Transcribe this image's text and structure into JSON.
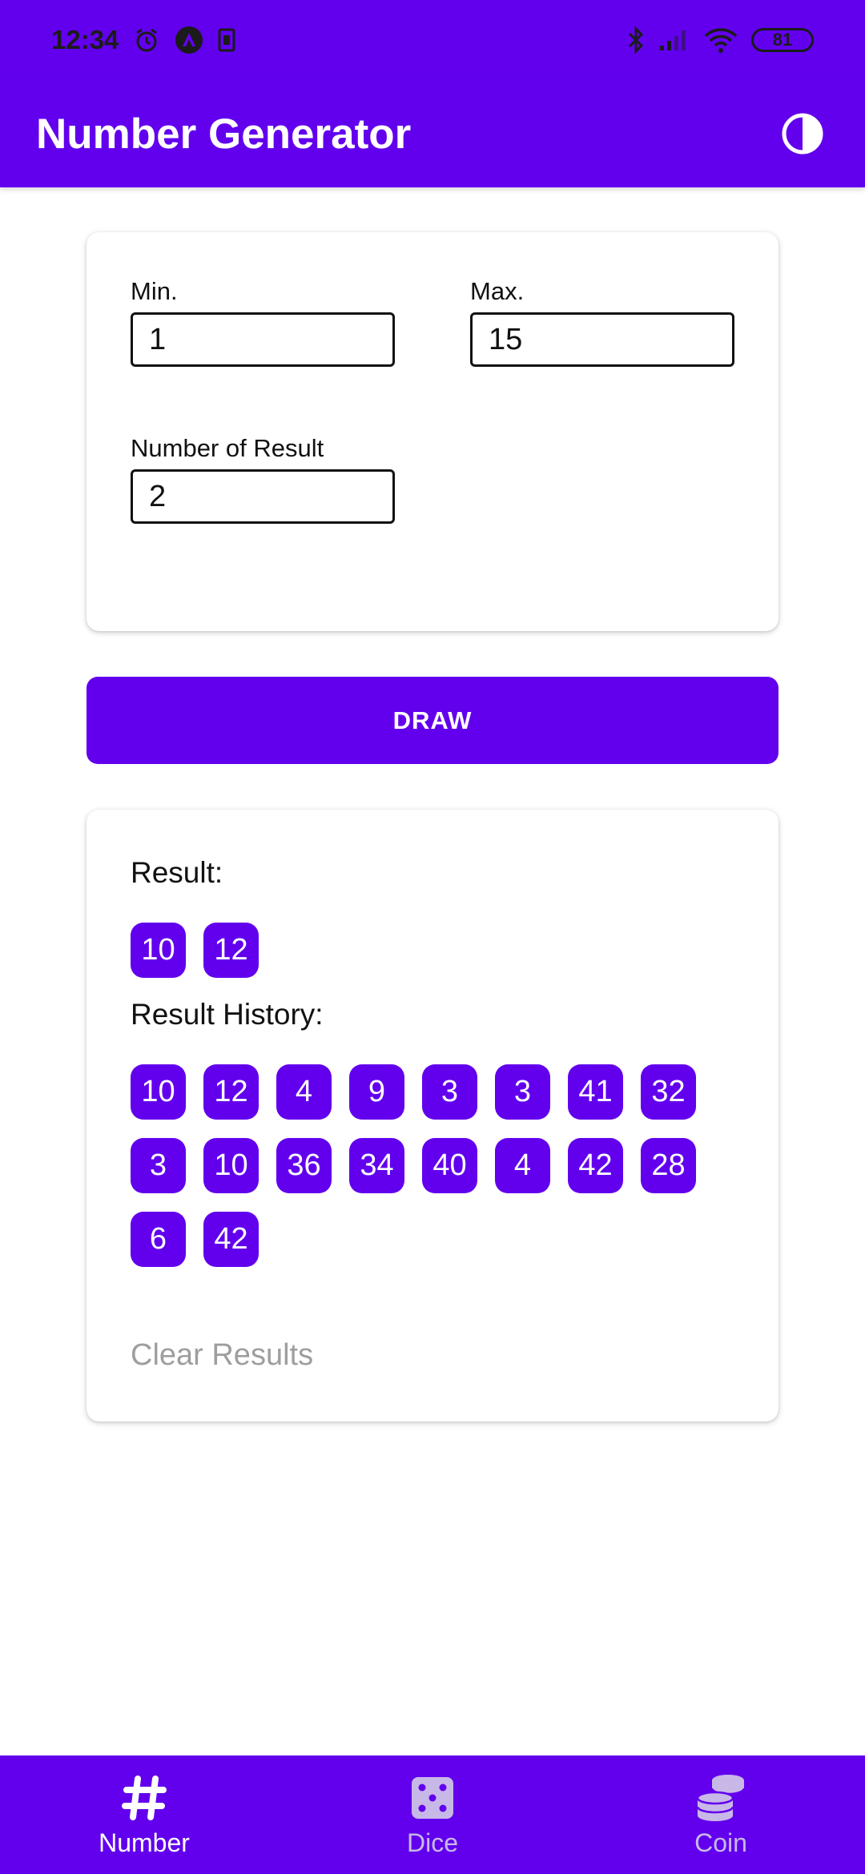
{
  "status_bar": {
    "time": "12:34",
    "battery": "81"
  },
  "app_bar": {
    "title": "Number Generator",
    "theme_icon": "contrast-icon"
  },
  "inputs": {
    "min_label": "Min.",
    "min_value": "1",
    "max_label": "Max.",
    "max_value": "15",
    "count_label": "Number of Result",
    "count_value": "2"
  },
  "draw_button": {
    "label": "DRAW"
  },
  "results": {
    "result_title": "Result:",
    "result_values": [
      "10",
      "12"
    ],
    "history_title": "Result History:",
    "history_values": [
      "10",
      "12",
      "4",
      "9",
      "3",
      "3",
      "41",
      "32",
      "3",
      "10",
      "36",
      "34",
      "40",
      "4",
      "42",
      "28",
      "6",
      "42"
    ],
    "clear_label": "Clear Results"
  },
  "bottom_nav": {
    "items": [
      {
        "label": "Number",
        "icon": "hash-icon",
        "active": true
      },
      {
        "label": "Dice",
        "icon": "dice-icon",
        "active": false
      },
      {
        "label": "Coin",
        "icon": "coins-icon",
        "active": false
      }
    ]
  },
  "colors": {
    "primary": "#6200ee",
    "inactive_nav": "#c8b8e8",
    "clear_text": "#9e9e9e"
  }
}
